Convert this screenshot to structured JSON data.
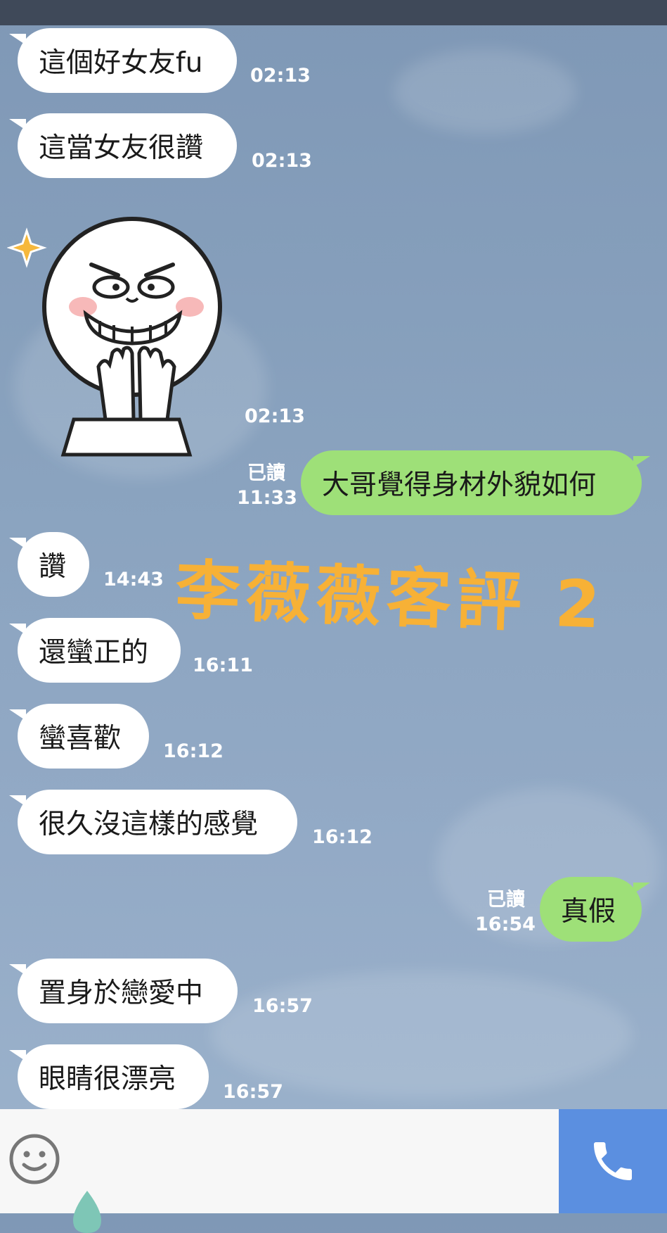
{
  "messages": [
    {
      "text": "這個好女友fu",
      "time": "02:13"
    },
    {
      "text": "這當女友很讚",
      "time": "02:13"
    },
    {
      "sticker_time": "02:13"
    },
    {
      "text": "大哥覺得身材外貌如何",
      "time": "11:33",
      "read": "已讀"
    },
    {
      "text": "讚",
      "time": "14:43"
    },
    {
      "text": "還蠻正的",
      "time": "16:11"
    },
    {
      "text": "蠻喜歡",
      "time": "16:12"
    },
    {
      "text": "很久沒這樣的感覺",
      "time": "16:12"
    },
    {
      "text": "真假",
      "time": "16:54",
      "read": "已讀"
    },
    {
      "text": "置身於戀愛中",
      "time": "16:57"
    },
    {
      "text": "眼睛很漂亮",
      "time": "16:57"
    }
  ],
  "overlay": {
    "watermark": "李薇薇客評 2"
  },
  "icons": {
    "sticker": "grinning-character-sticker",
    "emoji": "smiley-icon",
    "call": "phone-icon",
    "drop": "drop-icon"
  },
  "colors": {
    "incoming_bubble": "#ffffff",
    "outgoing_bubble": "#9ee078",
    "call_button": "#5b8fe0",
    "watermark": "#f7b136"
  }
}
